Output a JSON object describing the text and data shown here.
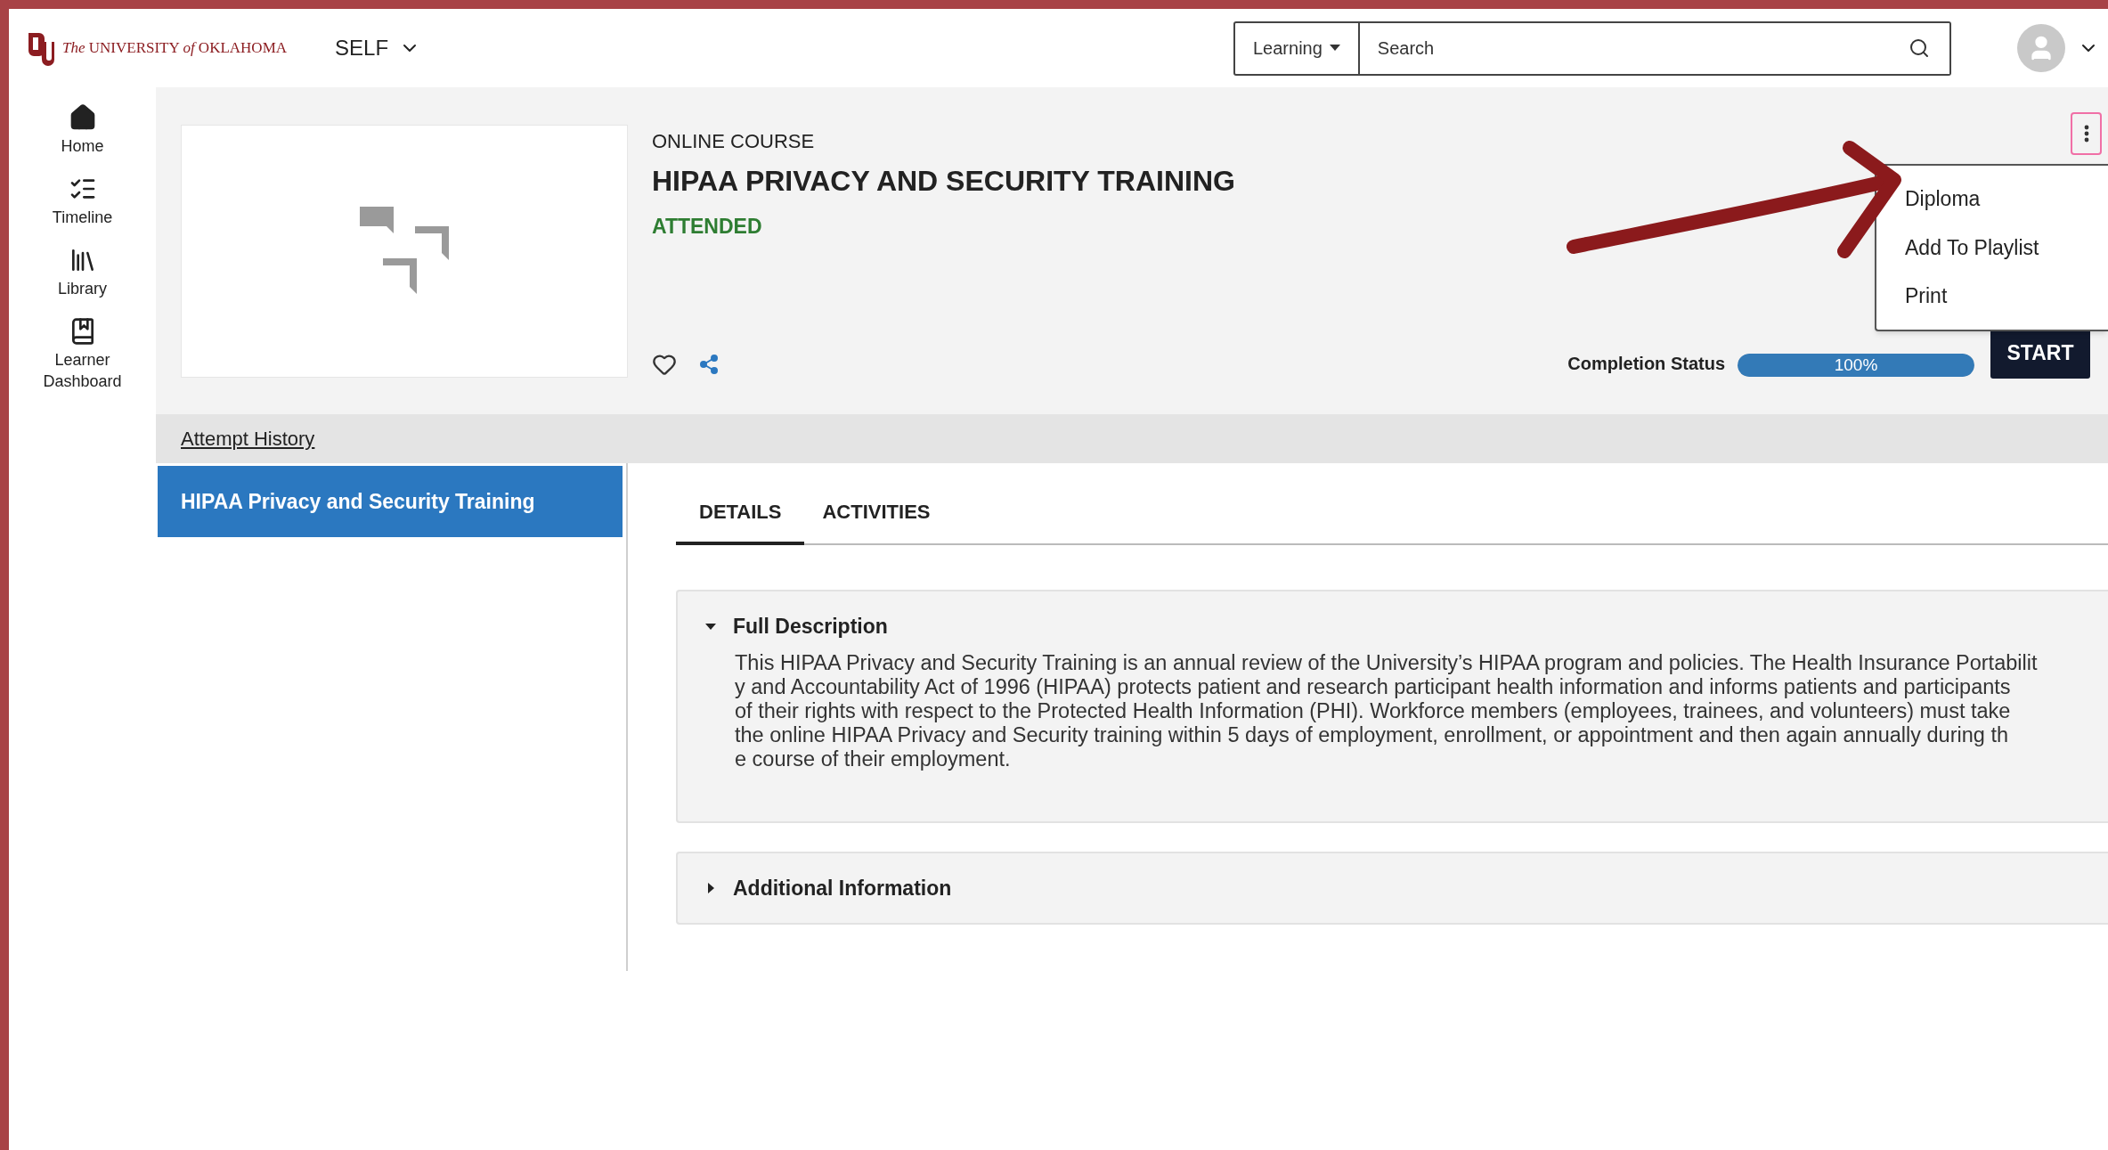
{
  "header": {
    "logo_text": "*The* UNIVERSITY *of* OKLAHOMA",
    "context_menu": "SELF",
    "search_scope": "Learning",
    "search": {
      "placeholder": "Search"
    }
  },
  "nav": [
    {
      "kind": "home",
      "label": "Home"
    },
    {
      "kind": "timeline",
      "label": "Timeline"
    },
    {
      "kind": "library",
      "label": "Library"
    },
    {
      "kind": "dashboard",
      "label": "Learner Dashboard"
    }
  ],
  "course": {
    "type": "ONLINE COURSE",
    "title": "HIPAA PRIVACY AND SECURITY TRAINING",
    "status": "ATTENDED",
    "completion_label": "Completion Status",
    "completion": {
      "level": 1,
      "reading": "100%"
    },
    "start_button": "START"
  },
  "more_menu": {
    "open": true,
    "items": [
      "Diploma",
      "Add To Playlist",
      "Print"
    ]
  },
  "attempt_history": "Attempt History",
  "modules": [
    {
      "label": "HIPAA Privacy and Security Training",
      "selected": true
    }
  ],
  "tabs": [
    {
      "label": "DETAILS",
      "selected": true
    },
    {
      "label": "ACTIVITIES",
      "selected": false
    }
  ],
  "sections": [
    {
      "title": "Full Description",
      "expanded": true,
      "lines": [
        "This HIPAA Privacy and Security Training is an annual review of the University’s HIPAA program and policies. The Health Insurance Portabilit",
        "y and Accountability Act of 1996 (HIPAA) protects patient and research participant health information and informs patients and participants",
        "of their rights with respect to the Protected Health Information (PHI). Workforce members (employees, trainees, and volunteers) must take",
        "the online HIPAA Privacy and Security training within 5 days of employment, enrollment, or appointment and then again annually during th",
        "e course of their employment."
      ]
    },
    {
      "title": "Additional Information",
      "expanded": false
    }
  ],
  "annotation": {
    "kind": "arrow"
  }
}
